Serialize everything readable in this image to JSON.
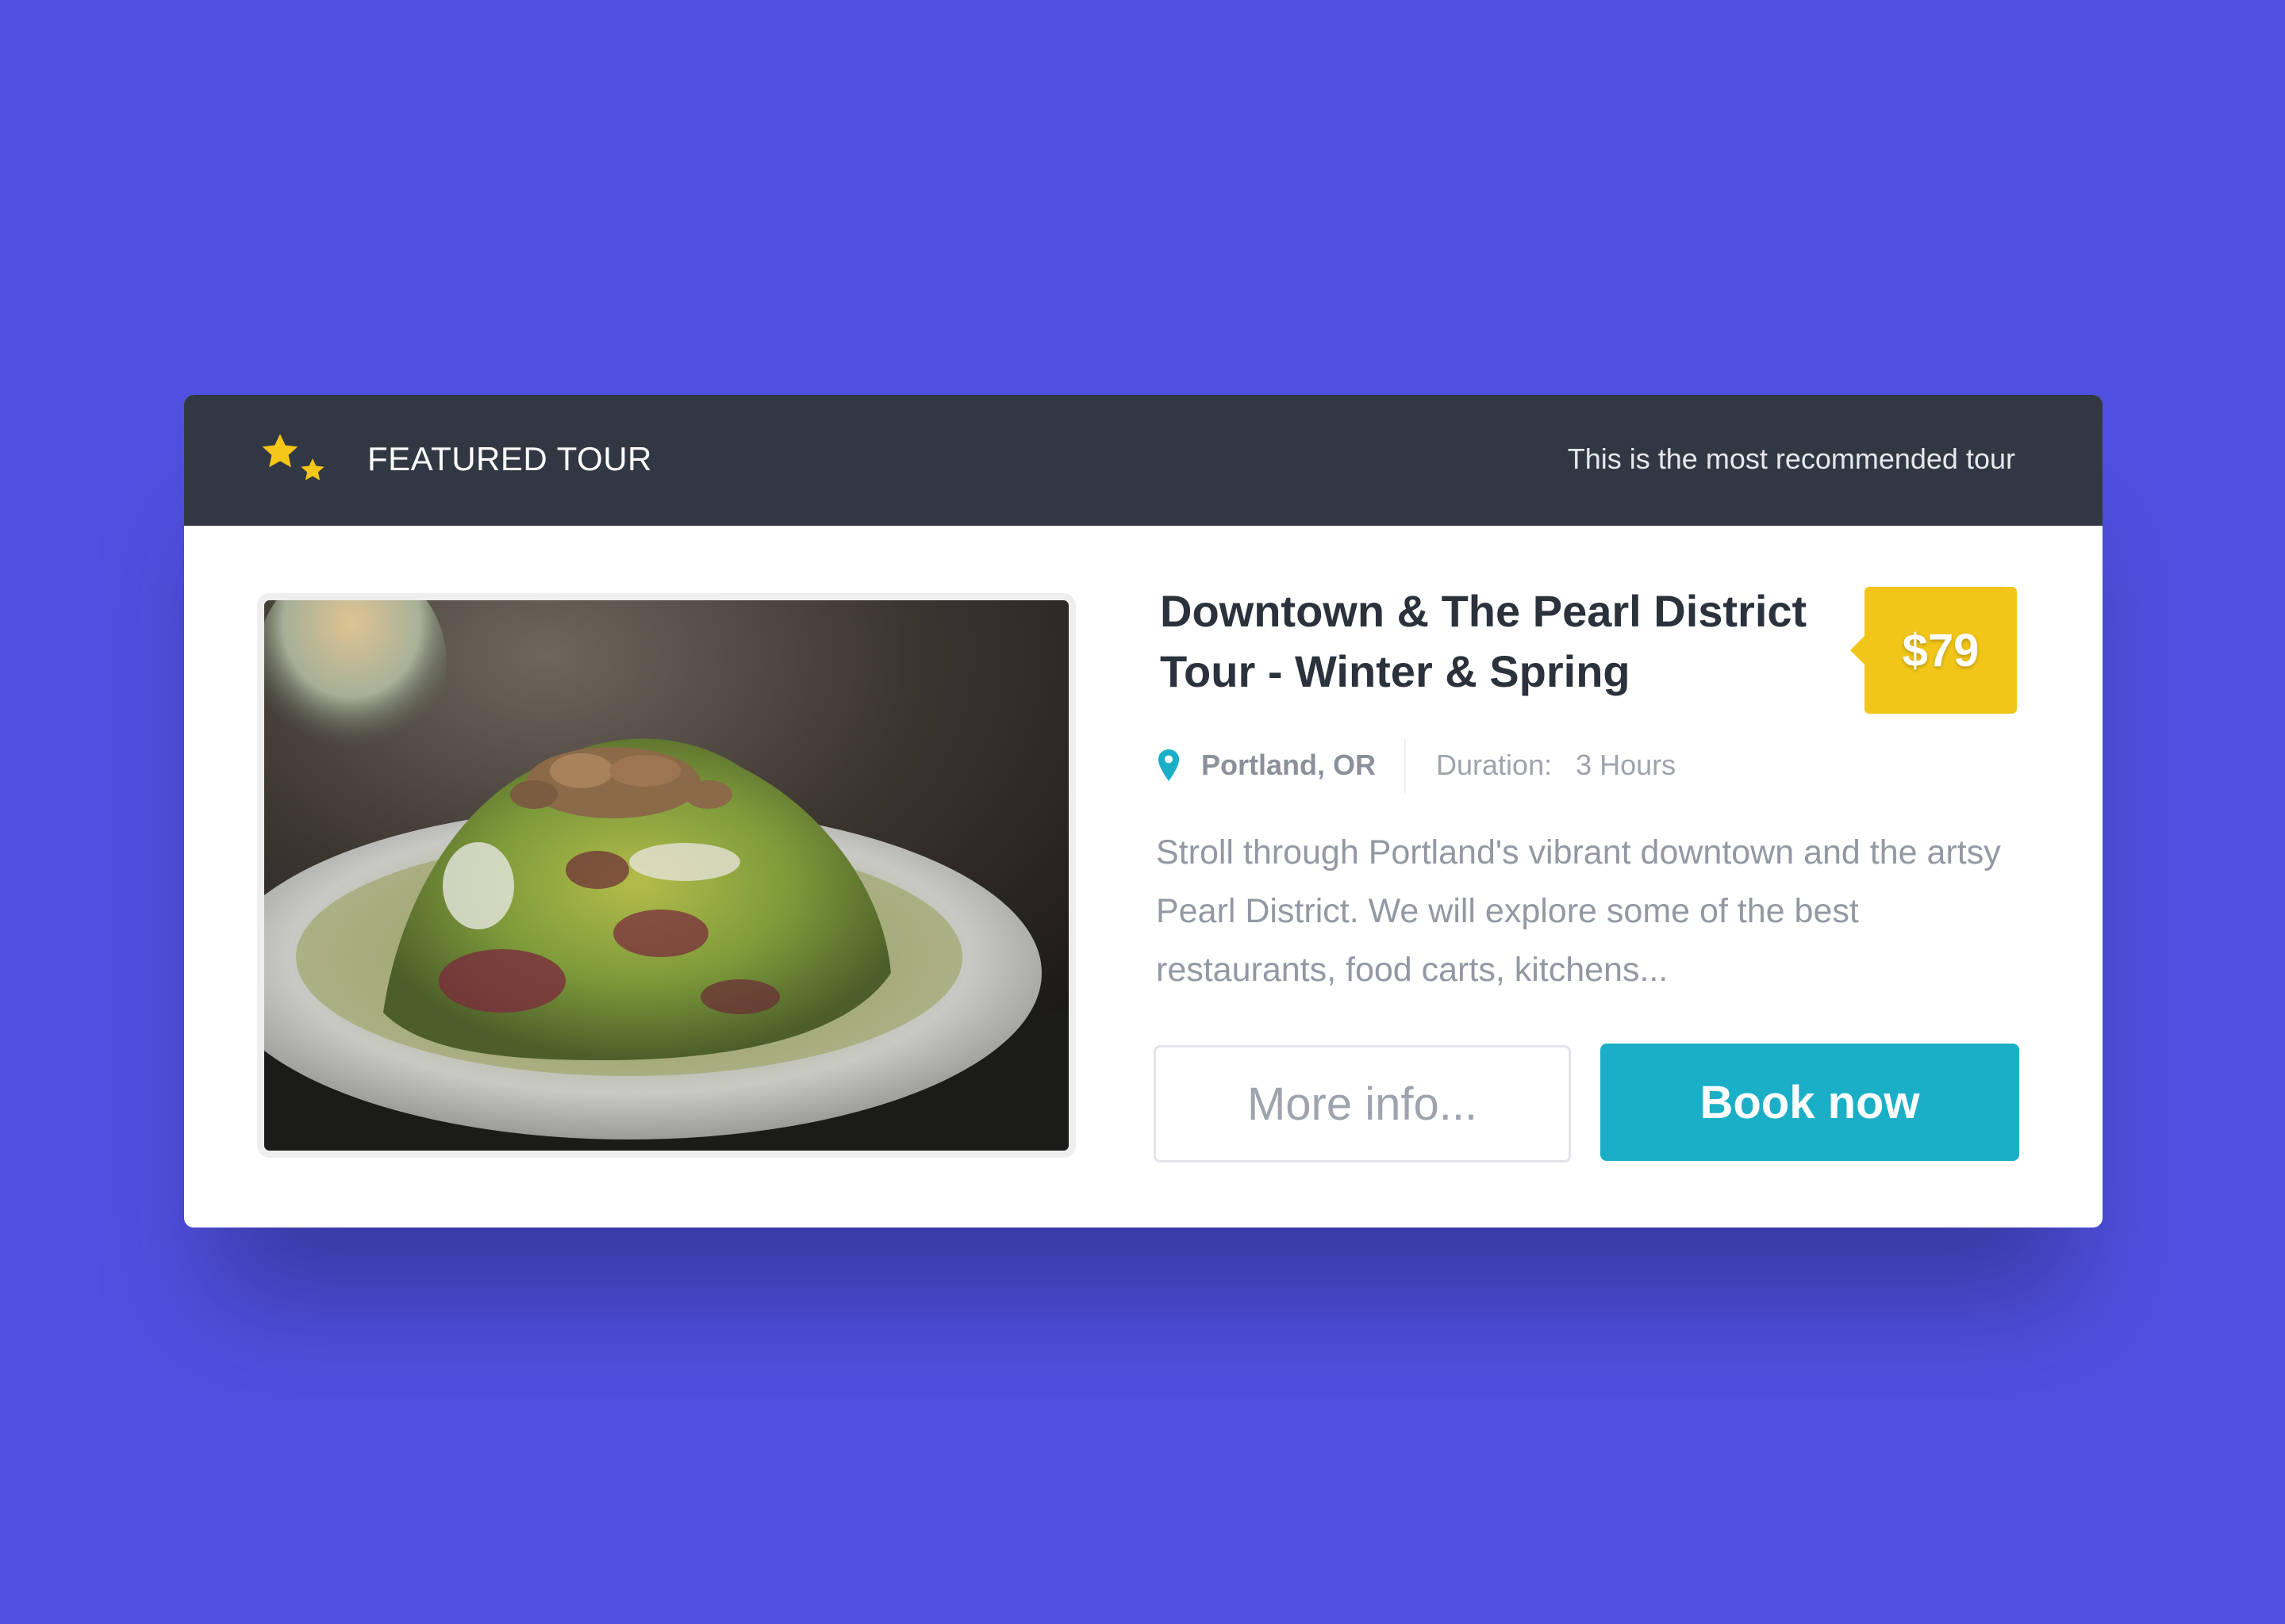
{
  "header": {
    "title": "FEATURED TOUR",
    "subtitle": "This is the most recommended tour",
    "icon": "stars-icon"
  },
  "tour": {
    "title": "Downtown & The Pearl District Tour - Winter & Spring",
    "price": "$79",
    "location": "Portland, OR",
    "duration_label": "Duration:",
    "duration_value": "3 Hours",
    "description": "Stroll through Portland's vibrant downtown and the artsy Pearl District. We will explore some of the best restaurants, food carts, kitchens...",
    "image_alt": "salad-photo"
  },
  "actions": {
    "more_info_label": "More info...",
    "book_label": "Book now"
  },
  "colors": {
    "background": "#5050e0",
    "header": "#323843",
    "accent": "#1aafc6",
    "price_tag": "#f2c618",
    "star": "#f5c518"
  }
}
